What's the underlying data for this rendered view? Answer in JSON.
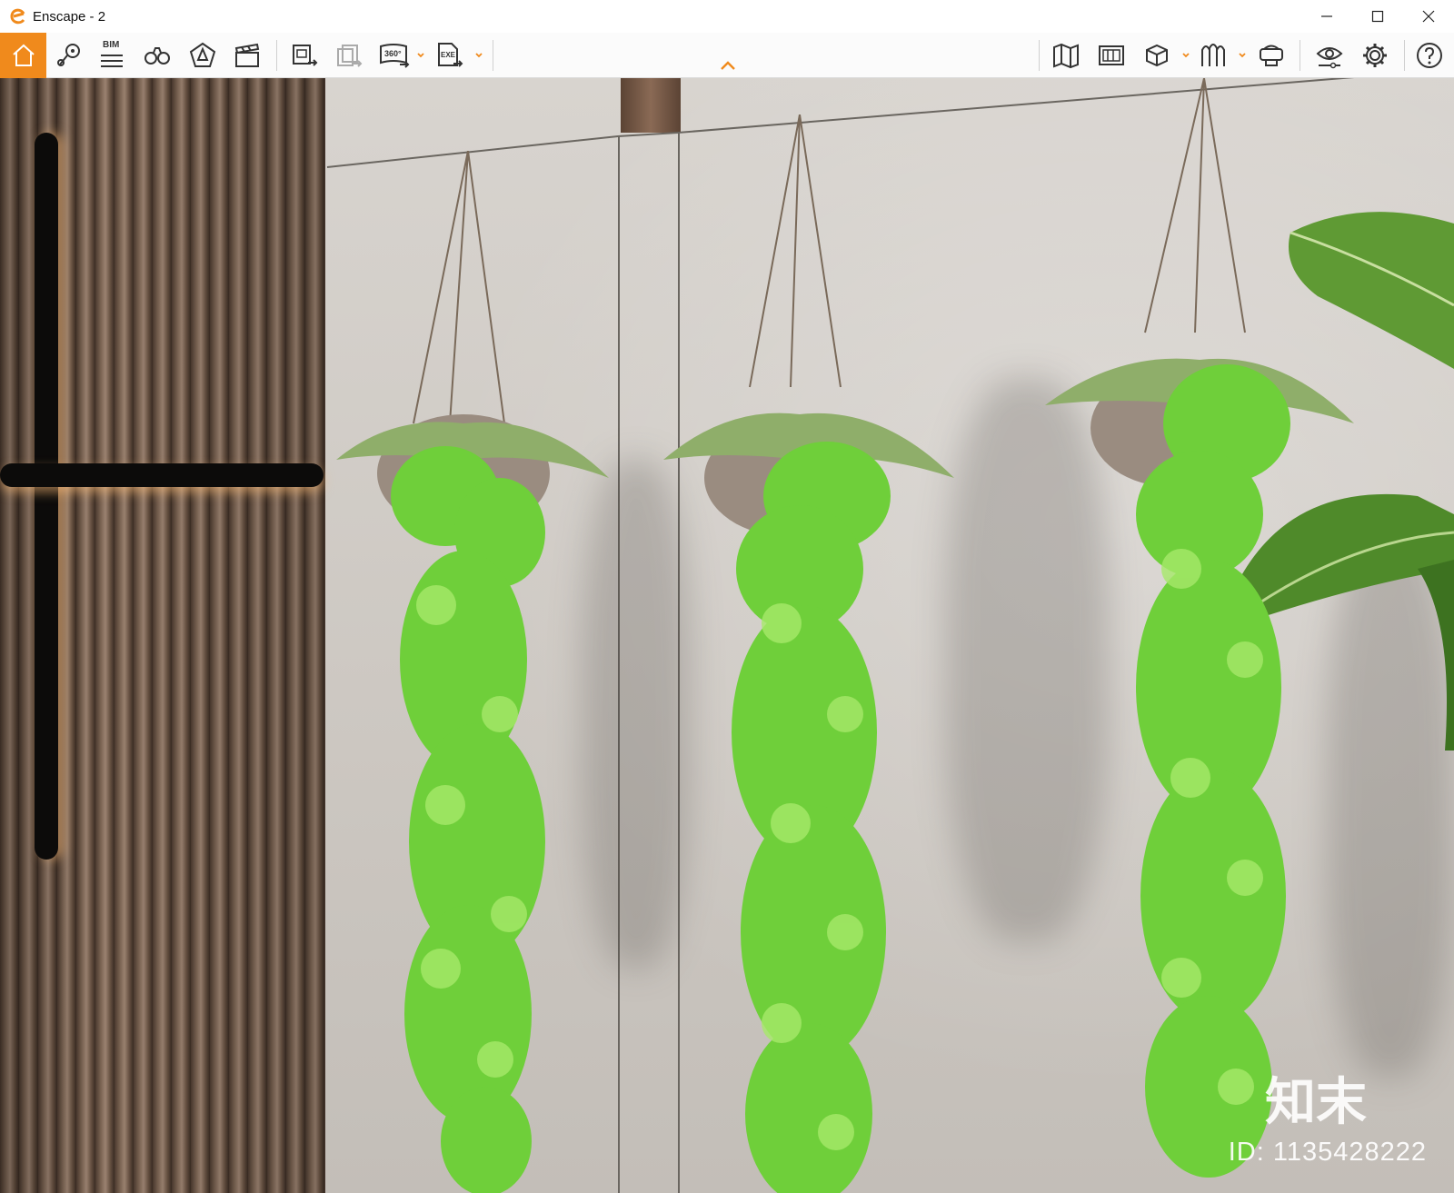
{
  "window": {
    "title": "Enscape - 2",
    "controls": [
      "minimize",
      "maximize",
      "close"
    ]
  },
  "toolbar": {
    "accent": "#f08a1c",
    "bim_label": "BIM",
    "pano_label": "360°",
    "exe_label": "EXE",
    "left_icons": [
      "home-icon",
      "location-pin-icon",
      "bim-list-icon",
      "binoculars-icon",
      "compass-icon",
      "clapperboard-icon",
      "screenshot-icon",
      "batch-render-icon",
      "panorama-360-icon",
      "export-exe-icon"
    ],
    "right_icons": [
      "map-icon",
      "asset-library-icon",
      "view-cube-icon",
      "atmosphere-icon",
      "vr-headset-icon",
      "visual-settings-icon",
      "settings-icon",
      "help-icon"
    ]
  },
  "watermark": {
    "logo_text": "知末",
    "id_text": "ID: 1135428222"
  }
}
